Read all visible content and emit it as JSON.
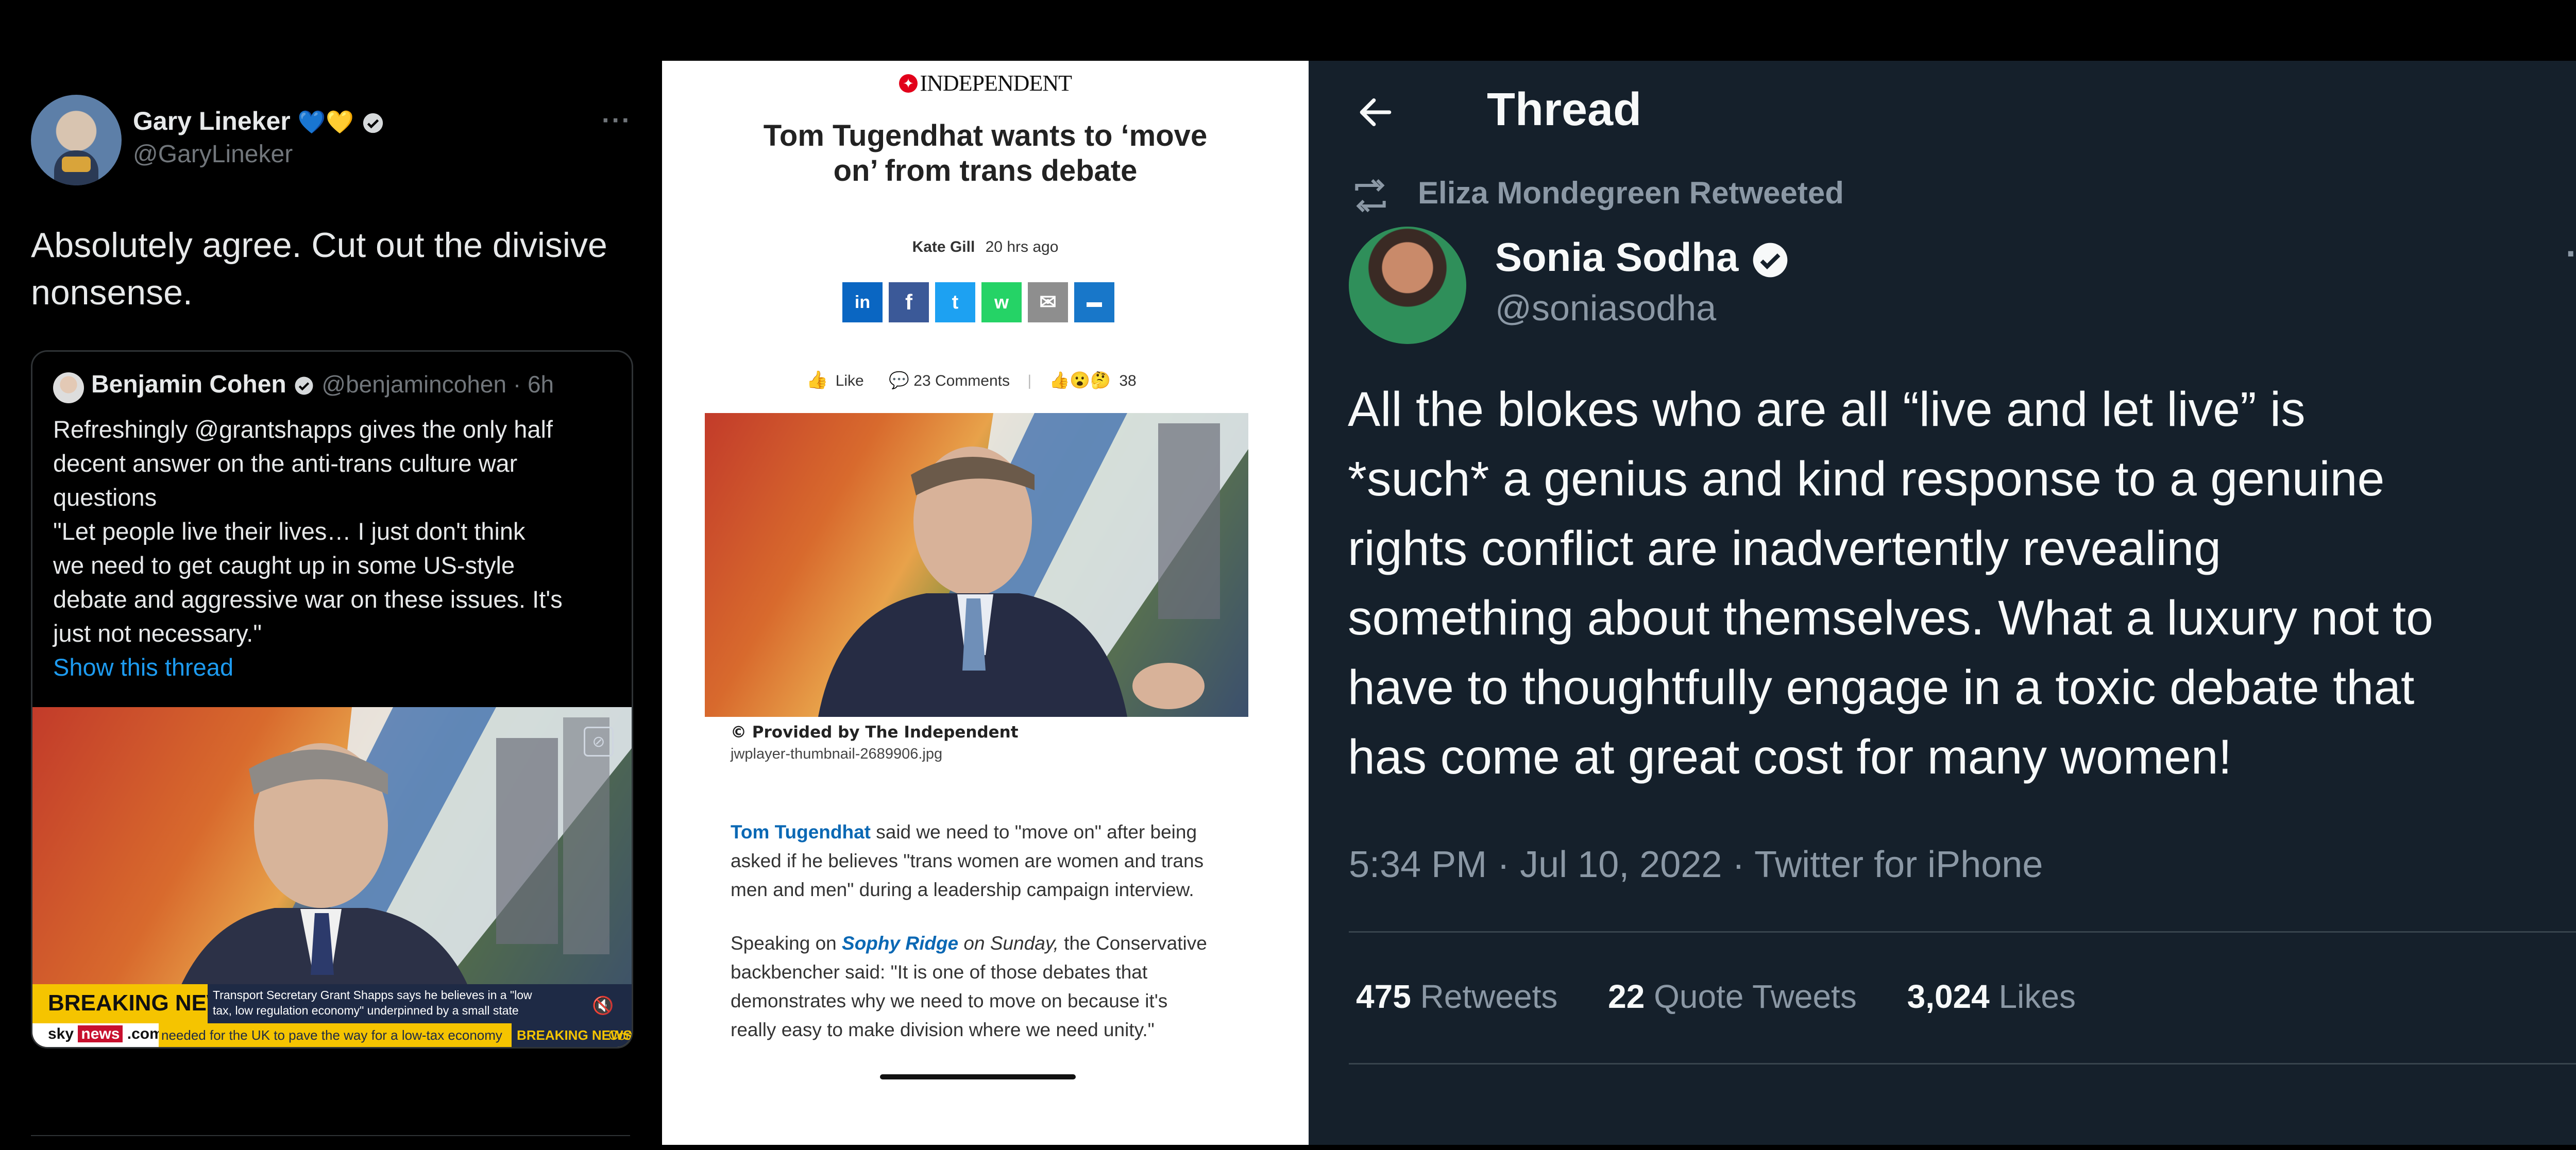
{
  "panel_left": {
    "author": {
      "name": "Gary Lineker",
      "emoji": "💙💛",
      "handle": "@GaryLineker"
    },
    "more_icon": "···",
    "tweet_text_line1": "Absolutely agree. Cut out the divisive",
    "tweet_text_line2": "nonsense.",
    "quote": {
      "name": "Benjamin Cohen",
      "handle_time": "@benjamincohen · 6h",
      "lines": [
        "Refreshingly @grantshapps gives the only half",
        "decent answer on the anti-trans culture war",
        "questions",
        "\"Let people live their lives… I just don't think",
        "we need to get caught up in some US-style",
        "debate and aggressive war on these issues. It's",
        "just not necessary.\""
      ],
      "show_thread": "Show this thread",
      "video": {
        "breaking": "BREAKING NEWS",
        "caption1": "Transport Secretary Grant Shapps says he believes in a \"low",
        "caption2": "tax, low regulation economy\" underpinned by a small state",
        "sky_text": "sky",
        "news_text": "news",
        "dotcom": ".com",
        "ticker": "needed for the UK to pave the way for a low-tax economy",
        "ticker_breaking": "BREAKING NEWS",
        "ticker_tail": "Conn"
      }
    }
  },
  "panel_middle": {
    "masthead": "INDEPENDENT",
    "headline_line1": "Tom Tugendhat wants to ‘move",
    "headline_line2": "on’ from trans debate",
    "author": "Kate Gill",
    "time_ago": "20 hrs ago",
    "share_buttons": [
      {
        "icon": "linkedin-icon",
        "glyph": "in",
        "color": "#0a66c2"
      },
      {
        "icon": "facebook-icon",
        "glyph": "f",
        "color": "#3b5998"
      },
      {
        "icon": "twitter-icon",
        "glyph": "t",
        "color": "#1da1f2"
      },
      {
        "icon": "whatsapp-icon",
        "glyph": "w",
        "color": "#25d366"
      },
      {
        "icon": "email-icon",
        "glyph": "✉",
        "color": "#8e8e8e"
      },
      {
        "icon": "comment-icon",
        "glyph": "▬",
        "color": "#1877c9"
      }
    ],
    "like_label": "Like",
    "comments_label": "23 Comments",
    "reaction_count": "38",
    "caption_bold": "© Provided by The Independent",
    "caption_file": "jwplayer-thumbnail-2689906.jpg",
    "para1_link": "Tom Tugendhat",
    "para1_line1": " said we need to \"move on\" after being",
    "para1_line2": "asked if he believes \"trans women are women and trans",
    "para1_line3": "men and men\" during a leadership campaign interview.",
    "para2_pre": "Speaking on ",
    "para2_link": "Sophy Ridge",
    "para2_italic": " on Sunday,",
    "para2_line1_tail": " the Conservative",
    "para2_line2": "backbencher said: \"It is one of those debates that",
    "para2_line3": "demonstrates why we need to move on because it's",
    "para2_line4": "really easy to make division where we need unity.\""
  },
  "panel_right": {
    "header_title": "Thread",
    "retweeted_by": "Eliza Mondegreen Retweeted",
    "author": {
      "name": "Sonia Sodha",
      "handle": "@soniasodha"
    },
    "more_icon": "···",
    "text_lines": [
      "All the blokes who are all “live and let live” is",
      "*such* a genius and kind response to a genuine",
      "rights conflict are inadvertently revealing",
      "something about themselves. What a luxury not to",
      "have to thoughtfully engage in a toxic debate that",
      "has come at great cost for many women!"
    ],
    "timestamp": "5:34 PM · Jul 10, 2022 · Twitter for iPhone",
    "stats": {
      "retweets_count": "475",
      "retweets_label": "Retweets",
      "quotes_count": "22",
      "quotes_label": "Quote Tweets",
      "likes_count": "3,024",
      "likes_label": "Likes"
    }
  }
}
